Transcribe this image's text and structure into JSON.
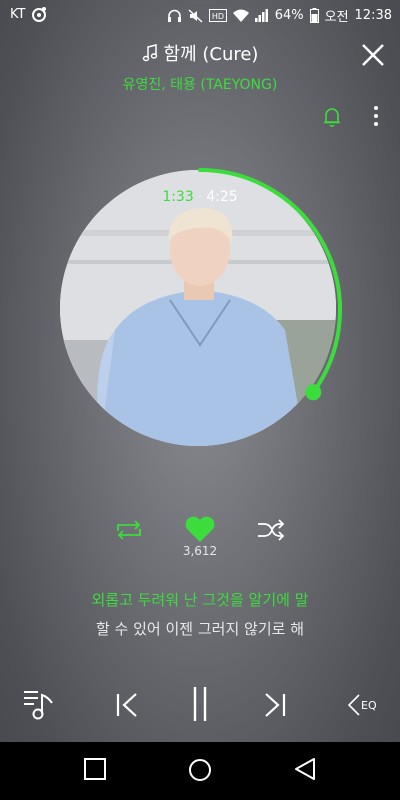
{
  "status_bar": {
    "carrier": "KT",
    "battery_percent": "64%",
    "period": "오전",
    "time": "12:38"
  },
  "track": {
    "title": "함께 (Cure)",
    "artist": "유영진, 태용 (TAEYONG)"
  },
  "progress": {
    "current": "1:33",
    "separator": "·",
    "total": "4:25",
    "fraction": 0.35
  },
  "like_count": "3,612",
  "lyrics": {
    "current": "외롭고 두려워 난 그것을 알기에 말",
    "next": "할 수 있어 이젠 그러지 않기로 해"
  },
  "eq_label": "EQ",
  "colors": {
    "accent": "#3ddc3d",
    "navbar": "#000000"
  },
  "icons": [
    "music-note-icon",
    "close-icon",
    "bell-icon",
    "more-icon",
    "repeat-icon",
    "heart-icon",
    "shuffle-icon",
    "playlist-icon",
    "previous-icon",
    "pause-icon",
    "next-icon",
    "eq-icon",
    "recent-apps-icon",
    "home-icon",
    "back-icon"
  ]
}
